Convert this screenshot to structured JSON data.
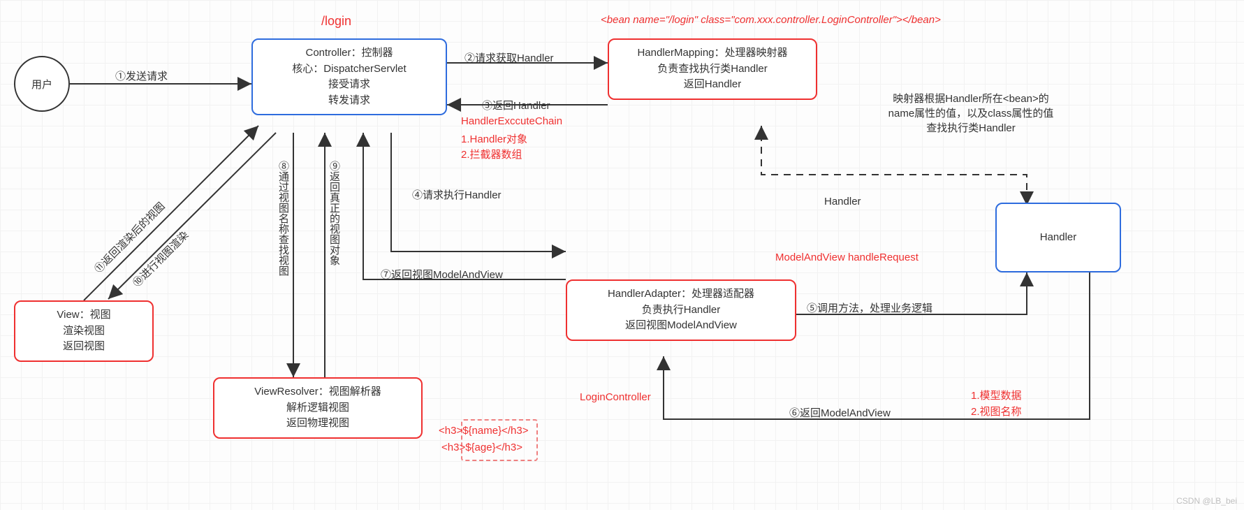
{
  "nodes": {
    "user": "用户",
    "controller": {
      "l1": "Controller：控制器",
      "l2": "核心：DispatcherServlet",
      "l3": "接受请求",
      "l4": "转发请求"
    },
    "handlerMapping": {
      "l1": "HandlerMapping：处理器映射器",
      "l2": "负责查找执行类Handler",
      "l3": "返回Handler"
    },
    "handlerAdapter": {
      "l1": "HandlerAdapter：处理器适配器",
      "l2": "负责执行Handler",
      "l3": "返回视图ModelAndView"
    },
    "handler": "Handler",
    "view": {
      "l1": "View：视图",
      "l2": "渲染视图",
      "l3": "返回视图"
    },
    "viewResolver": {
      "l1": "ViewResolver：视图解析器",
      "l2": "解析逻辑视图",
      "l3": "返回物理视图"
    }
  },
  "edges": {
    "e1": "①发送请求",
    "e2": "②请求获取Handler",
    "e3": "③返回Handler",
    "e4": "④请求执行Handler",
    "e5": "⑤调用方法，处理业务逻辑",
    "e6": "⑥返回ModelAndView",
    "e7": "⑦返回视图ModelAndView",
    "e8": "⑧通过视图名称查找视图",
    "e9": "⑨返回真正的视图对象",
    "e10": "⑩进行视图渲染",
    "e11": "⑪返回渲染后的视图",
    "handlerDashed": "Handler"
  },
  "annotations": {
    "loginPath": "/login",
    "beanDef": "<bean name=\"/login\" class=\"com.xxx.controller.LoginController\"></bean>",
    "exChainTitle": "HandlerExccuteChain",
    "exChain1": "1.Handler对象",
    "exChain2": "2.拦截器数组",
    "mappingNote1": "映射器根据Handler所在<bean>的",
    "mappingNote2": "name属性的值，以及class属性的值",
    "mappingNote3": "查找执行类Handler",
    "handleRequest": "ModelAndView handleRequest",
    "loginController": "LoginController",
    "mv1": "1.模型数据",
    "mv2": "2.视图名称",
    "tpl1": "<h3>${name}</h3>",
    "tpl2": "<h3>${age}</h3>"
  },
  "watermark": "CSDN @LB_bei"
}
